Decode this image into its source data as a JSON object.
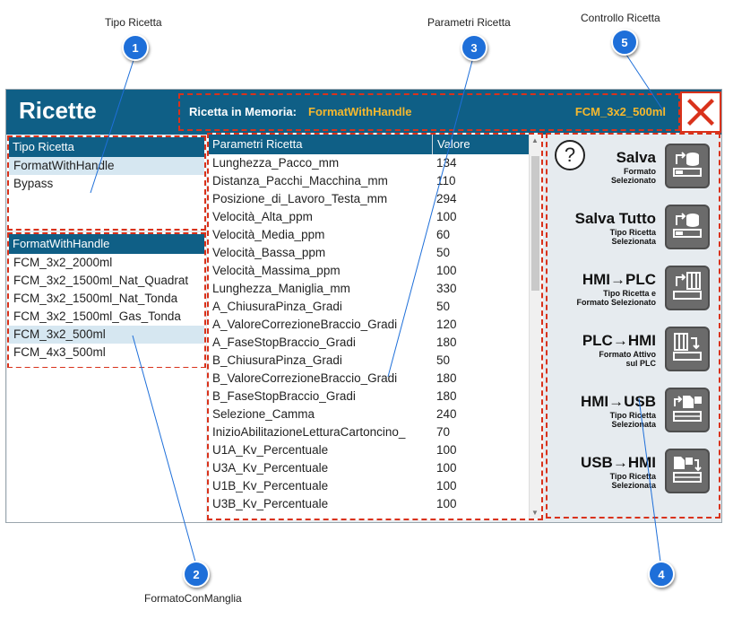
{
  "callouts": {
    "c1": {
      "number": "1",
      "label": "Tipo Ricetta"
    },
    "c2": {
      "number": "2",
      "label": "FormatoConManglia"
    },
    "c3": {
      "number": "3",
      "label": "Parametri Ricetta"
    },
    "c4": {
      "number": "4"
    },
    "c5": {
      "number": "5",
      "label": "Controllo Ricetta"
    }
  },
  "header": {
    "title": "Ricette",
    "memory_label": "Ricetta in Memoria:",
    "memory_value": "FormatWithHandle",
    "format_value": "FCM_3x2_500ml",
    "close_icon": "close-x-icon"
  },
  "recipe_types": {
    "header": "Tipo Ricetta",
    "items": [
      "FormatWithHandle",
      "Bypass"
    ],
    "selected": "FormatWithHandle"
  },
  "formats": {
    "header": "FormatWithHandle",
    "items": [
      "FCM_3x2_2000ml",
      "FCM_3x2_1500ml_Nat_Quadrat",
      "FCM_3x2_1500ml_Nat_Tonda",
      "FCM_3x2_1500ml_Gas_Tonda",
      "FCM_3x2_500ml",
      "FCM_4x3_500ml"
    ],
    "selected": "FCM_3x2_500ml"
  },
  "params": {
    "col_name": "Parametri Ricetta",
    "col_value": "Valore",
    "rows": [
      {
        "name": "Lunghezza_Pacco_mm",
        "value": "134"
      },
      {
        "name": "Distanza_Pacchi_Macchina_mm",
        "value": "110"
      },
      {
        "name": "Posizione_di_Lavoro_Testa_mm",
        "value": "294"
      },
      {
        "name": "Velocità_Alta_ppm",
        "value": "100"
      },
      {
        "name": "Velocità_Media_ppm",
        "value": "60"
      },
      {
        "name": "Velocità_Bassa_ppm",
        "value": "50"
      },
      {
        "name": "Velocità_Massima_ppm",
        "value": "100"
      },
      {
        "name": "Lunghezza_Maniglia_mm",
        "value": "330"
      },
      {
        "name": "A_ChiusuraPinza_Gradi",
        "value": "50"
      },
      {
        "name": "A_ValoreCorrezioneBraccio_Gradi",
        "value": "120"
      },
      {
        "name": "A_FaseStopBraccio_Gradi",
        "value": "180"
      },
      {
        "name": "B_ChiusuraPinza_Gradi",
        "value": "50"
      },
      {
        "name": "B_ValoreCorrezioneBraccio_Gradi",
        "value": "180"
      },
      {
        "name": "B_FaseStopBraccio_Gradi",
        "value": "180"
      },
      {
        "name": "Selezione_Camma",
        "value": "240"
      },
      {
        "name": "InizioAbilitazioneLetturaCartoncino_",
        "value": "70"
      },
      {
        "name": "U1A_Kv_Percentuale",
        "value": "100"
      },
      {
        "name": "U3A_Kv_Percentuale",
        "value": "100"
      },
      {
        "name": "U1B_Kv_Percentuale",
        "value": "100"
      },
      {
        "name": "U3B_Kv_Percentuale",
        "value": "100"
      }
    ]
  },
  "actions": {
    "help_label": "?",
    "items": [
      {
        "title": "Salva",
        "sub1": "Formato",
        "sub2": "Selezionato",
        "icon": "save-format-icon"
      },
      {
        "title": "Salva Tutto",
        "sub1": "Tipo Ricetta",
        "sub2": "Selezionata",
        "icon": "save-all-icon"
      },
      {
        "title": "HMI→PLC",
        "sub1": "Tipo Ricetta e",
        "sub2": "Formato Selezionato",
        "icon": "hmi-to-plc-icon"
      },
      {
        "title": "PLC→HMI",
        "sub1": "Formato Attivo",
        "sub2": "sul PLC",
        "icon": "plc-to-hmi-icon"
      },
      {
        "title": "HMI→USB",
        "sub1": "Tipo Ricetta",
        "sub2": "Selezionata",
        "icon": "hmi-to-usb-icon"
      },
      {
        "title": "USB→HMI",
        "sub1": "Tipo Ricetta",
        "sub2": "Selezionata",
        "icon": "usb-to-hmi-icon"
      }
    ]
  },
  "colors": {
    "header_blue": "#0f5f86",
    "accent_orange": "#f5b82e",
    "dashed_red": "#d9321b",
    "badge_blue": "#1e6fd9",
    "selection": "#d6e7f1"
  }
}
